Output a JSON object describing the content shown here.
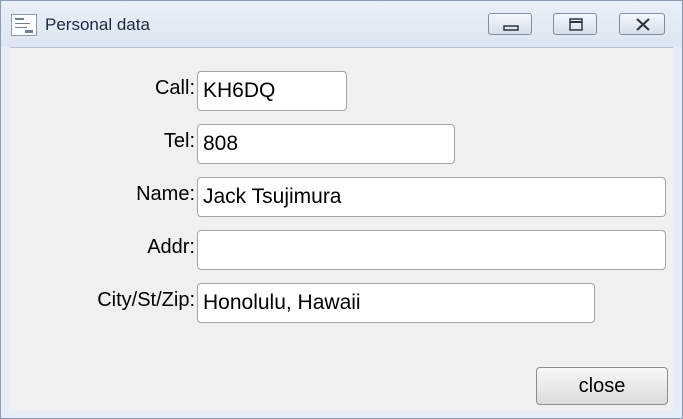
{
  "window": {
    "title": "Personal data"
  },
  "titlebar_buttons": {
    "minimize": "minimize-icon",
    "maximize": "maximize-icon",
    "close": "close-icon"
  },
  "form": {
    "call": {
      "label": "Call:",
      "value": "KH6DQ"
    },
    "tel": {
      "label": "Tel:",
      "value": "808"
    },
    "name": {
      "label": "Name:",
      "value": "Jack Tsujimura"
    },
    "addr": {
      "label": "Addr:",
      "value": ""
    },
    "city": {
      "label": "City/St/Zip:",
      "value": "Honolulu, Hawaii"
    }
  },
  "actions": {
    "close_label": "close"
  },
  "colors": {
    "titlebar": "#dde6f1",
    "content_bg": "#f0f0f0",
    "field_border": "#a4a4a4"
  }
}
